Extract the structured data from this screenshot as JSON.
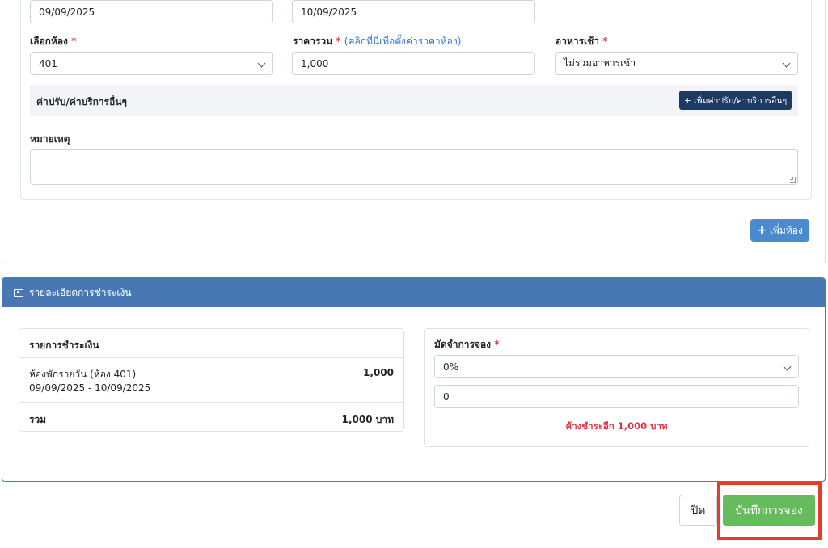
{
  "room_form": {
    "check_in_date": "09/09/2025",
    "check_out_date": "10/09/2025",
    "room_label": "เลือกห้อง",
    "room_value": "401",
    "price_label": "ราคารวม",
    "price_hint": "(คลิกที่นี่เพื่อตั้งค่าราคาห้อง)",
    "price_value": "1,000",
    "breakfast_label": "อาหารเช้า",
    "breakfast_value": "ไม่รวมอาหารเช้า",
    "required_mark": "*",
    "fees_title": "ค่าปรับ/ค่าบริการอื่นๆ",
    "add_fee_button": "+ เพิ่มค่าปรับ/ค่าบริการอื่นๆ",
    "note_label": "หมายเหตุ",
    "note_value": "",
    "add_room_button": "เพิ่มห้อง",
    "add_room_icon": "+"
  },
  "payment": {
    "header_title": "รายละเอียดการชำระเงิน",
    "header_icon": "money-bill-icon",
    "list_title": "รายการชำระเงิน",
    "item_name": "ห้องพักรายวัน (ห้อง 401)",
    "item_dates": "09/09/2025 - 10/09/2025",
    "item_amount": "1,000",
    "total_label": "รวม",
    "total_amount": "1,000 บาท",
    "deposit_label": "มัดจำการจอง",
    "deposit_percent": "0%",
    "deposit_amount": "0",
    "outstanding_text": "ค้างชำระอีก 1,000 บาท"
  },
  "footer": {
    "close_button": "ปิด",
    "save_button": "บันทึกการจอง"
  },
  "colors": {
    "header_blue": "#4778b3",
    "save_green": "#66bb5c",
    "dark_button": "#1c3a63",
    "add_room_blue": "#4a8ad0",
    "highlight_red": "#e53b2c",
    "danger_red": "#dc3545"
  }
}
